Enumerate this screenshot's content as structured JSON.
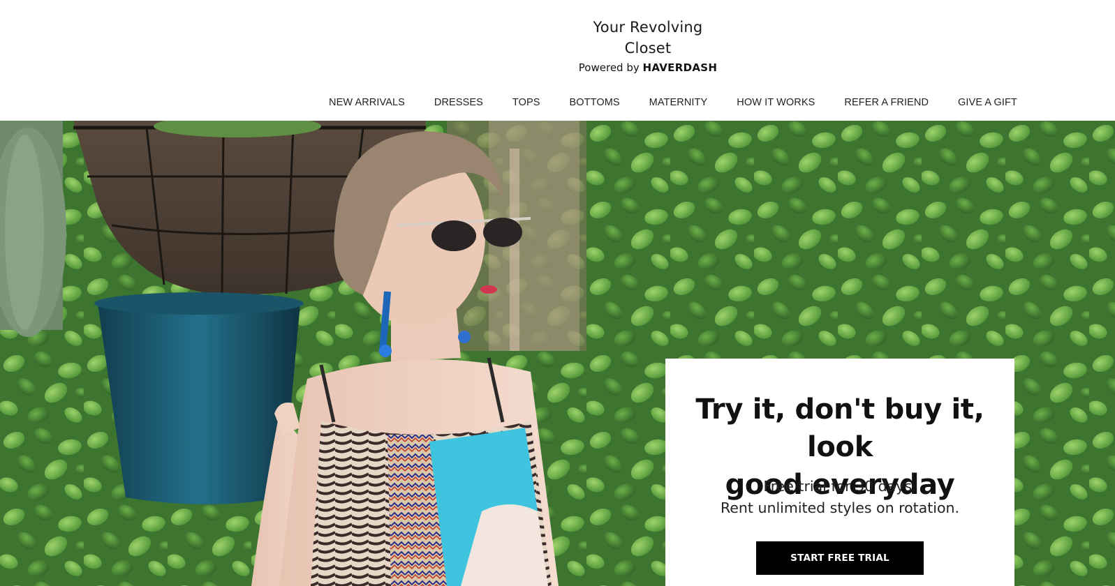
{
  "brand": {
    "line1": "Your Revolving",
    "line2": "Closet",
    "powered_prefix": "Powered by",
    "powered_name": "HAVERDASH"
  },
  "nav": {
    "items": [
      {
        "label": "NEW ARRIVALS"
      },
      {
        "label": "DRESSES"
      },
      {
        "label": "TOPS"
      },
      {
        "label": "BOTTOMS"
      },
      {
        "label": "MATERNITY"
      },
      {
        "label": "HOW IT WORKS"
      },
      {
        "label": "REFER A FRIEND"
      },
      {
        "label": "GIVE A GIFT"
      }
    ]
  },
  "hero": {
    "headline_line1": "Try it, don't buy it, look",
    "headline_line2": "good everyday",
    "sub_line1": "Free trial for 30 days.",
    "sub_line2": "Rent unlimited styles on rotation.",
    "cta_label": "START FREE TRIAL"
  },
  "colors": {
    "cta_bg": "#000000",
    "cta_text": "#ffffff",
    "foliage": "#3f7a32",
    "pot": "#1f5a6e",
    "dress_accent": "#3fc4e0"
  }
}
